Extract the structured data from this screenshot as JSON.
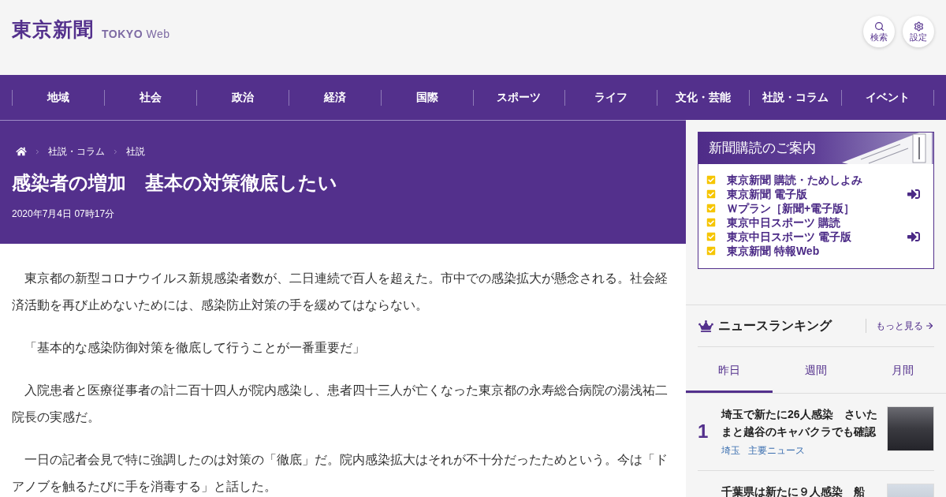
{
  "header": {
    "logo": "東京新聞",
    "site_name": "**TOKYO** Web",
    "buttons": [
      {
        "kind": "search",
        "label": "検索"
      },
      {
        "kind": "settings",
        "label": "設定"
      }
    ]
  },
  "nav": [
    "地域",
    "社会",
    "政治",
    "経済",
    "国際",
    "スポーツ",
    "ライフ",
    "文化・芸能",
    "社説・コラム",
    "イベント"
  ],
  "article": {
    "breadcrumb": [
      "社説・コラム",
      "社説"
    ],
    "title": "感染者の増加　基本の対策徹底したい",
    "date": "2020年7月4日 07時17分",
    "paragraphs": [
      "東京都の新型コロナウイルス新規感染者数が、二日連続で百人を超えた。市中での感染拡大が懸念される。社会経済活動を再び止めないためには、感染防止対策の手を緩めてはならない。",
      "「基本的な感染防御対策を徹底して行うことが一番重要だ」",
      "入院患者と医療従事者の計二百十四人が院内感染し、患者四十三人が亡くなった東京都の永寿総合病院の湯浅祐二院長の実感だ。",
      "一日の記者会見で特に強調したのは対策の「徹底」だ。院内感染拡大はそれが不十分だったためという。今は「ドアノブを触るたびに手を消毒する」と話した。"
    ]
  },
  "subscription": {
    "title": "新聞購読のご案内",
    "items": [
      {
        "label": "東京新聞 購読・ためしよみ",
        "login_icon": false
      },
      {
        "label": "東京新聞 電子版",
        "login_icon": true
      },
      {
        "label": "Ｗプラン［新聞+電子版］",
        "login_icon": false
      },
      {
        "label": "東京中日スポーツ 購読",
        "login_icon": false
      },
      {
        "label": "東京中日スポーツ 電子版",
        "login_icon": true
      },
      {
        "label": "東京新聞 特報Web",
        "login_icon": false
      }
    ]
  },
  "ranking": {
    "title": "ニュースランキング",
    "more": "もっと見る",
    "tabs": [
      {
        "label": "昨日",
        "selected": true
      },
      {
        "label": "週間",
        "selected": false
      },
      {
        "label": "月間",
        "selected": false
      }
    ],
    "items": [
      {
        "rank": "1",
        "title": "埼玉で新たに26人感染　さいたまと越谷のキャバクラでも確認",
        "tags": [
          "埼玉",
          "主要ニュース"
        ]
      },
      {
        "title": "千葉県は新たに９人感染　船"
      }
    ]
  }
}
